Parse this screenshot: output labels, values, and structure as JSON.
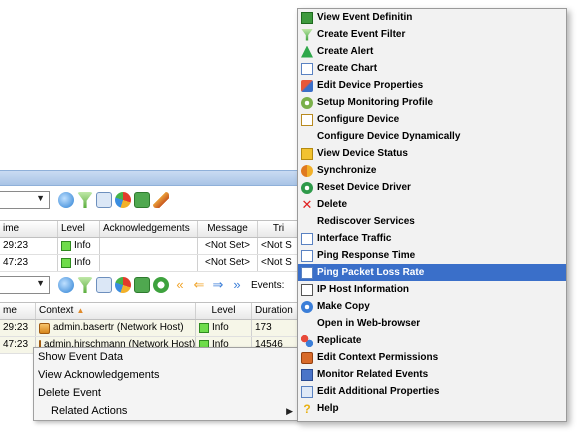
{
  "toolbar_top": {
    "icons": [
      "refresh-icon",
      "filter-icon",
      "form-icon",
      "pie-chart-icon",
      "save-icon",
      "brush-icon"
    ]
  },
  "grid1": {
    "headers": [
      "ime",
      "Level",
      "Acknowledgements",
      "Message",
      "Tri"
    ],
    "rows": [
      {
        "time": "29:23",
        "level": "Info",
        "ack": "",
        "message": "<Not Set>",
        "trigger": "<Not S"
      },
      {
        "time": "47:23",
        "level": "Info",
        "ack": "",
        "message": "<Not Set>",
        "trigger": "<Not S"
      }
    ]
  },
  "toolbar_bottom": {
    "events_label": "Events:"
  },
  "grid2": {
    "headers": [
      "me",
      "Context",
      "Level",
      "Duration"
    ],
    "rows": [
      {
        "time": "29:23",
        "context": "admin.basertr (Network Host)",
        "level": "Info",
        "duration": "173"
      },
      {
        "time": "47:23",
        "context": "admin.hirschmann (Network Host)",
        "level": "Info",
        "duration": "14546"
      }
    ]
  },
  "context_menu": {
    "items": [
      "Show Event Data",
      "View Acknowledgements",
      "Delete Event",
      "Related Actions"
    ]
  },
  "popup_menu": {
    "items": [
      {
        "label": "View Event Definitin",
        "icon": "doc-icon"
      },
      {
        "label": "Create Event Filter",
        "icon": "funnel-icon"
      },
      {
        "label": "Create Alert",
        "icon": "alert-icon"
      },
      {
        "label": "Create Chart",
        "icon": "chart-icon"
      },
      {
        "label": "Edit Device Properties",
        "icon": "wrench-icon"
      },
      {
        "label": "Setup Monitoring Profile",
        "icon": "profile-icon"
      },
      {
        "label": "Configure Device",
        "icon": "config-icon"
      },
      {
        "label": "Configure Device Dynamically",
        "icon": ""
      },
      {
        "label": "View Device Status",
        "icon": "status-icon"
      },
      {
        "label": "Synchronize",
        "icon": "sync-icon"
      },
      {
        "label": "Reset Device Driver",
        "icon": "reset-icon"
      },
      {
        "label": "Delete",
        "icon": "delete-icon"
      },
      {
        "label": "Rediscover Services",
        "icon": ""
      },
      {
        "label": "Interface Traffic",
        "icon": "chart-icon"
      },
      {
        "label": "Ping Response Time",
        "icon": "chart-icon"
      },
      {
        "label": "Ping Packet Loss Rate",
        "icon": "chart-icon",
        "highlighted": true
      },
      {
        "label": "IP Host Information",
        "icon": "info-icon"
      },
      {
        "label": "Make Copy",
        "icon": "copy-icon"
      },
      {
        "label": "Open in Web-browser",
        "icon": ""
      },
      {
        "label": "Replicate",
        "icon": "replicate-icon"
      },
      {
        "label": "Edit Context Permissions",
        "icon": "permissions-icon"
      },
      {
        "label": "Monitor Related Events",
        "icon": "monitor-icon"
      },
      {
        "label": "Edit Additional Properties",
        "icon": "properties-icon"
      },
      {
        "label": "Help",
        "icon": "help-icon"
      }
    ]
  },
  "colors": {
    "menu_highlight": "#3a6fc9",
    "titlebar": "#b7cfee",
    "info_green": "#6edc4a"
  }
}
